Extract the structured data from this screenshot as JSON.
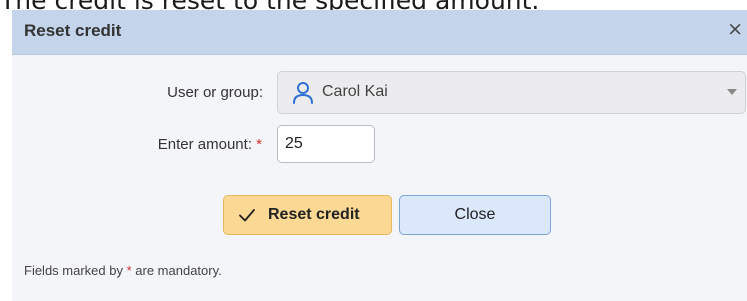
{
  "caption": "The credit is reset to the specified amount.",
  "dialog": {
    "title": "Reset credit",
    "close_glyph": "×",
    "user_label": "User or group:",
    "user_value": "Carol Kai",
    "user_icon": "user-icon",
    "amount_label": "Enter amount:",
    "required_mark": "*",
    "amount_value": "25",
    "reset_button_label": "Reset credit",
    "close_button_label": "Close",
    "footnote_before": "Fields marked by ",
    "footnote_mark": "*",
    "footnote_after": " are mandatory."
  },
  "colors": {
    "titlebar": "#c4d4ea",
    "primary_button": "#fbd894",
    "secondary_button": "#dbe7fa",
    "required": "#d93030",
    "user_icon": "#2f6fd6"
  }
}
